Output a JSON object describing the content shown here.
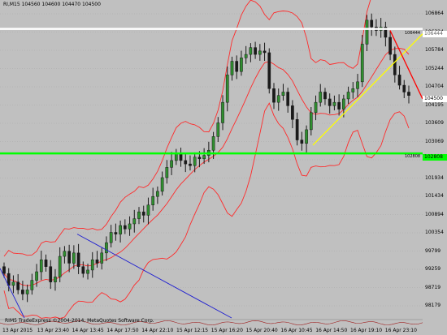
{
  "header": {
    "symbol": "RI,M15",
    "ohlc": "104560 104600 104470 104500"
  },
  "footer": {
    "copyright": "RIM5 TradeExpress ©2004-2014, MetaQuotes Software Corp."
  },
  "price_axis": {
    "ticks": [
      "106864",
      "106324",
      "105784",
      "105244",
      "104704",
      "104195",
      "103609",
      "103069",
      "102529",
      "101934",
      "101434",
      "100894",
      "100354",
      "99799",
      "99259",
      "98719",
      "98179"
    ],
    "current_price": "104500",
    "white_line_label": "106444",
    "green_line_label": "102808"
  },
  "time_axis": {
    "labels": [
      "13 Apr 2015",
      "13 Apr 23:40",
      "14 Apr 13:45",
      "14 Apr 17:50",
      "14 Apr 22:10",
      "15 Apr 12:15",
      "15 Apr 16:20",
      "15 Apr 20:40",
      "16 Apr 10:45",
      "16 Apr 14:50",
      "16 Apr 19:10",
      "16 Apr 23:10"
    ]
  },
  "colors": {
    "background": "#c0c0c0",
    "candle_up": "#1a1a1a",
    "candle_body_up": "#2f8f2f",
    "candle_body_down": "#1a1a1a",
    "bollinger": "#ff2a2a",
    "white_line": "#ffffff",
    "green_line": "#00ff00",
    "yellow_trend": "#ffff00",
    "red_trend": "#ff0000",
    "blue_trend": "#2020d0",
    "grid": "#a8a8a8"
  },
  "chart_data": {
    "type": "candlestick",
    "ylim": [
      98000,
      107100
    ],
    "horizontal_lines": [
      106444,
      102808
    ],
    "closes": [
      99300,
      98950,
      99050,
      98820,
      98700,
      98820,
      99100,
      99350,
      99700,
      99500,
      99050,
      99200,
      99800,
      99950,
      99600,
      99900,
      99500,
      99300,
      99400,
      99700,
      99600,
      99900,
      100200,
      100500,
      100450,
      100700,
      100600,
      100750,
      100900,
      101100,
      101000,
      101300,
      101550,
      101700,
      102100,
      102400,
      102600,
      102800,
      102600,
      102500,
      102450,
      102700,
      102650,
      102750,
      102900,
      103300,
      103700,
      104300,
      105100,
      105500,
      105200,
      105600,
      105700,
      105900,
      105700,
      105800,
      105750,
      104700,
      104300,
      104500,
      104600,
      104200,
      103800,
      103200,
      103100,
      103500,
      104000,
      104300,
      104600,
      104400,
      104200,
      104300,
      104100,
      104400,
      104600,
      104700,
      104900,
      106000,
      106700,
      106500,
      106400,
      106500,
      106200,
      105700,
      105100,
      104800,
      104600,
      104500
    ]
  }
}
